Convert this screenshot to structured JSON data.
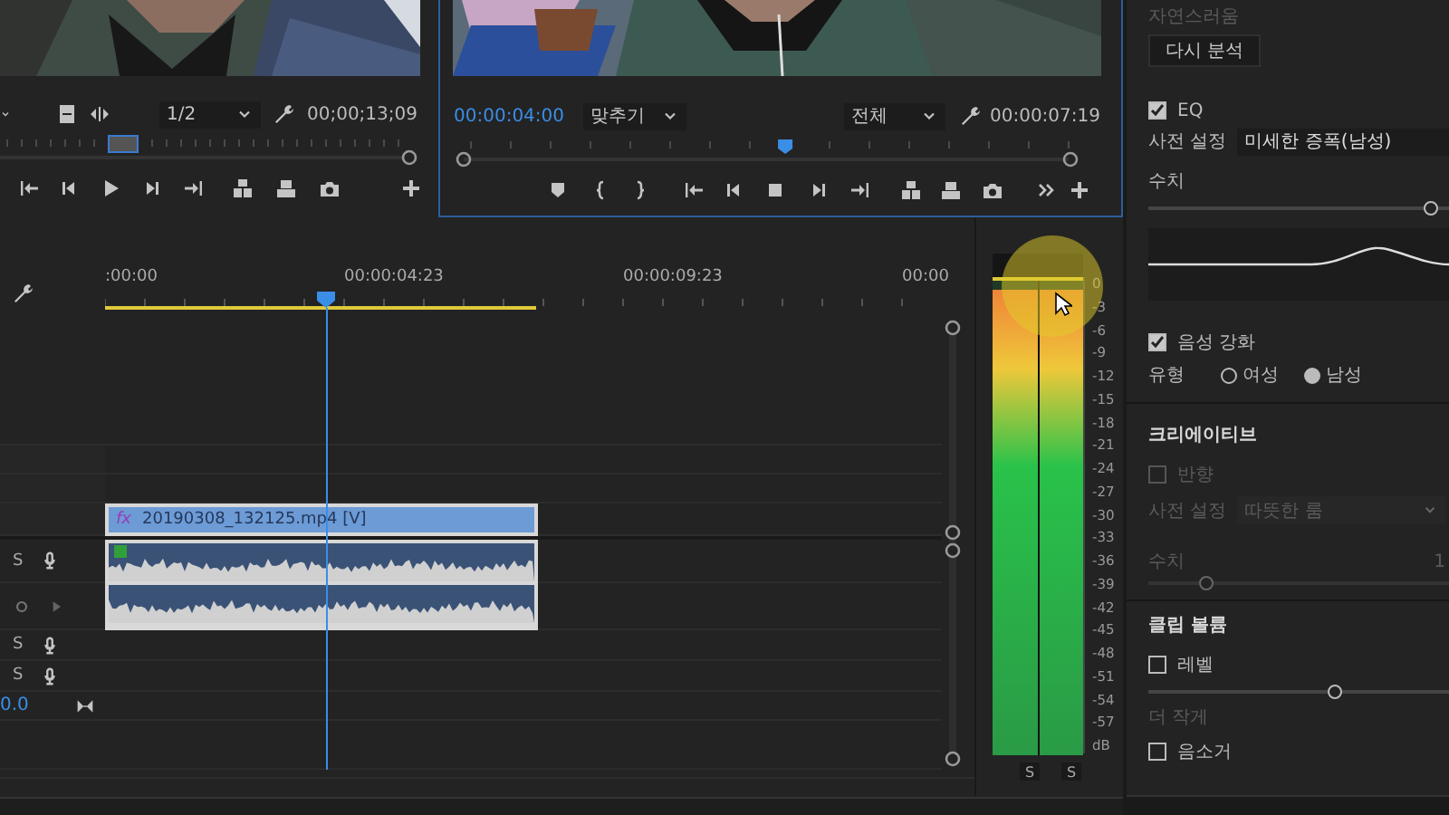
{
  "source_monitor": {
    "zoom": "1/2",
    "timecode": "00;00;13;09"
  },
  "program_monitor": {
    "timecode": "00:00:04:00",
    "zoom": "맞추기",
    "quality": "전체",
    "duration": "00:00:07:19",
    "scrubber": {
      "level": 0.53
    }
  },
  "timeline": {
    "ruler_labels": [
      ":00:00",
      "00:00:04:23",
      "00:00:09:23",
      "00:00"
    ],
    "playhead": {
      "level": 0.264
    },
    "video_clip": {
      "fx_badge": "fx",
      "name": "20190308_132125.mp4 [V]"
    },
    "track_controls": [
      {
        "kind": "audio",
        "solo": "S"
      },
      {
        "kind": "keyframes"
      },
      {
        "kind": "audio",
        "solo": "S"
      },
      {
        "kind": "audio",
        "solo": "S"
      },
      {
        "kind": "master",
        "value": "0.0"
      }
    ]
  },
  "audio_meter": {
    "scale": [
      "0",
      "-3",
      "-6",
      "-9",
      "-12",
      "-15",
      "-18",
      "-21",
      "-24",
      "-27",
      "-30",
      "-33",
      "-36",
      "-39",
      "-42",
      "-45",
      "-48",
      "-51",
      "-54",
      "-57",
      "dB"
    ],
    "channels": [
      {
        "level": 0.98,
        "solo": "S"
      },
      {
        "level": 0.98,
        "solo": "S"
      }
    ]
  },
  "essential_sound": {
    "top_label": "자연스러움",
    "reanalyze_button": "다시 분석",
    "eq": {
      "label": "EQ",
      "checked": true,
      "preset_label": "사전 설정",
      "preset": "미세한 증폭(남성)",
      "amount_label": "수치",
      "level": 0.94
    },
    "enhance_speech": {
      "label": "음성 강화",
      "checked": true,
      "type_label": "유형",
      "options": [
        {
          "label": "여성",
          "selected": false
        },
        {
          "label": "남성",
          "selected": true
        }
      ]
    },
    "creative": {
      "title": "크리에이티브",
      "disabled": true,
      "reverb_label": "반향",
      "checked": false,
      "preset_label": "사전 설정",
      "preset": "따뜻한 룸",
      "amount_label": "수치",
      "amount_value": "1",
      "level": 0.19
    },
    "clip_volume": {
      "title": "클립 볼륨",
      "level_label": "레벨",
      "checked": false,
      "level": 0.62,
      "quieter_label": "더 작게",
      "mute_label": "음소거",
      "mute_checked": false
    }
  }
}
